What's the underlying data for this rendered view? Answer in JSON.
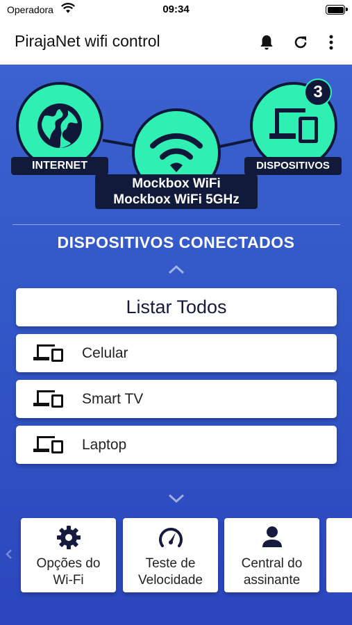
{
  "status_bar": {
    "carrier": "Operadora",
    "time": "09:34"
  },
  "app_bar": {
    "title": "PirajaNet wifi control",
    "actions": [
      "bell-icon",
      "refresh-icon",
      "more-vert-icon"
    ]
  },
  "network": {
    "internet_label": "INTERNET",
    "devices_label": "DISPOSITIVOS",
    "device_count": "3",
    "ssid_primary": "Mockbox WiFi",
    "ssid_secondary": "Mockbox WiFi 5GHz"
  },
  "connected": {
    "title": "DISPOSITIVOS CONECTADOS",
    "list_all_label": "Listar Todos",
    "devices": [
      {
        "icon": "devices-icon",
        "name": "Celular"
      },
      {
        "icon": "devices-icon",
        "name": "Smart TV"
      },
      {
        "icon": "devices-icon",
        "name": "Laptop"
      }
    ]
  },
  "shortcuts": [
    {
      "icon": "gear-icon",
      "line1": "Opções do",
      "line2": "Wi-Fi"
    },
    {
      "icon": "speedometer-icon",
      "line1": "Teste de",
      "line2": "Velocidade"
    },
    {
      "icon": "person-icon",
      "line1": "Central do",
      "line2": "assinante"
    }
  ],
  "colors": {
    "accent": "#2ff0b2",
    "dark": "#10183a",
    "background_blue": "#3257c7"
  }
}
